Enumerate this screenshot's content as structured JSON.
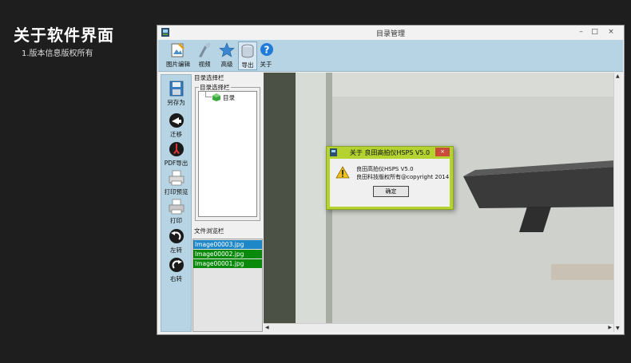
{
  "page": {
    "title": "关于软件界面",
    "subtitle": "1.版本信息版权所有"
  },
  "window": {
    "title": "目录管理",
    "controls": {
      "minimize": "–",
      "maximize": "□",
      "close": "×"
    }
  },
  "toolbar": {
    "items": [
      {
        "label": "图片编辑",
        "icon": "image-edit-icon"
      },
      {
        "label": "视频",
        "icon": "video-icon"
      },
      {
        "label": "高级",
        "icon": "star-icon"
      },
      {
        "label": "导出",
        "icon": "export-icon"
      },
      {
        "label": "关于",
        "icon": "help-icon"
      }
    ]
  },
  "leftbar": {
    "items": [
      {
        "label": "另存为",
        "icon": "save-as-icon"
      },
      {
        "label": "迁移",
        "icon": "migrate-icon"
      },
      {
        "label": "PDF导出",
        "icon": "pdf-export-icon"
      },
      {
        "label": "打印预览",
        "icon": "print-preview-icon"
      },
      {
        "label": "打印",
        "icon": "print-icon"
      },
      {
        "label": "左转",
        "icon": "rotate-left-icon"
      },
      {
        "label": "右转",
        "icon": "rotate-right-icon"
      }
    ]
  },
  "directory_panel": {
    "header": "目录选择栏",
    "group_label": "目录选择栏",
    "tree_root": "目录"
  },
  "file_panel": {
    "header": "文件浏览栏",
    "files": [
      {
        "name": "Image00003.jpg",
        "color": "#1e87c8"
      },
      {
        "name": "Image00002.jpg",
        "color": "#0a8a0a"
      },
      {
        "name": "Image00001.jpg",
        "color": "#0a8a0a"
      }
    ]
  },
  "about_dialog": {
    "title": "关于 良田高拍仪HSPS V5.0",
    "close": "×",
    "line1": "良田高拍仪HSPS V5.0",
    "line2": "良田科技版权所有@copyright 2014",
    "ok_label": "确定",
    "accent": "#b4d230"
  }
}
